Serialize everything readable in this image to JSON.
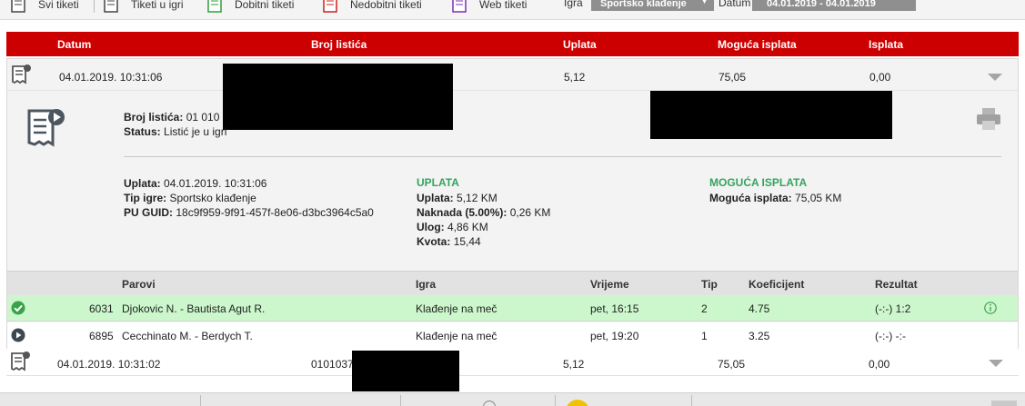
{
  "filters": {
    "all_tickets": "Svi tiketi",
    "active_tickets": "Tiketi u igri",
    "winning_tickets": "Dobitni tiketi",
    "losing_tickets": "Nedobitni tiketi",
    "web_tickets": "Web tiketi",
    "game_label": "Igra",
    "game_value": "Sportsko klađenje",
    "date_label": "Datum",
    "date_value": "04.01.2019 - 04.01.2019"
  },
  "columns": {
    "date": "Datum",
    "ticket_no": "Broj listića",
    "payment": "Uplata",
    "possible_payout": "Moguća isplata",
    "payout": "Isplata"
  },
  "ticket1": {
    "date": "04.01.2019. 10:31:06",
    "payment": "5,12",
    "possible_payout": "75,05",
    "payout": "0,00",
    "details": {
      "ticket_no_label": "Broj listića:",
      "ticket_no_value": "01 010",
      "status_label": "Status:",
      "status_value": "Listić je u igri",
      "paid_label": "Uplata:",
      "paid_value": "04.01.2019. 10:31:06",
      "game_type_label": "Tip igre:",
      "game_type_value": "Sportsko klađenje",
      "guid_label": "PU GUID:",
      "guid_value": "18c9f959-9f91-457f-8e06-d3bc3964c5a0"
    },
    "payment_section": {
      "title": "UPLATA",
      "amount_label": "Uplata:",
      "amount_value": "5,12 KM",
      "fee_label": "Naknada (5.00%):",
      "fee_value": "0,26 KM",
      "stake_label": "Ulog:",
      "stake_value": "4,86 KM",
      "odds_label": "Kvota:",
      "odds_value": "15,44"
    },
    "payout_section": {
      "title": "MOGUĆA ISPLATA",
      "label": "Moguća isplata:",
      "value": "75,05 KM"
    },
    "pair_columns": {
      "pairs": "Parovi",
      "game": "Igra",
      "time": "Vrijeme",
      "tip": "Tip",
      "coef": "Koeficijent",
      "result": "Rezultat"
    },
    "pairs": [
      {
        "code": "6031",
        "match": "Djokovic N. - Bautista Agut R.",
        "game": "Klađenje na meč",
        "time": "pet, 16:15",
        "tip": "2",
        "coef": "4.75",
        "result": "(-:-) 1:2"
      },
      {
        "code": "6895",
        "match": "Cecchinato M. - Berdych T.",
        "game": "Klađenje na meč",
        "time": "pet, 19:20",
        "tip": "1",
        "coef": "3.25",
        "result": "(-:-) -:-"
      }
    ]
  },
  "ticket2": {
    "date": "04.01.2019. 10:31:02",
    "ticket_no": "0101037",
    "payment": "5,12",
    "possible_payout": "75,05",
    "payout": "0,00"
  },
  "colors": {
    "header_red": "#cc0000",
    "win_green": "#ccf7cc",
    "section_green": "#35a35f",
    "panel_gray": "#f3f3f3"
  },
  "icons": [
    "ticket-icon",
    "print-icon",
    "chevron-down-icon",
    "check-circle-icon",
    "play-circle-icon",
    "info-icon"
  ]
}
